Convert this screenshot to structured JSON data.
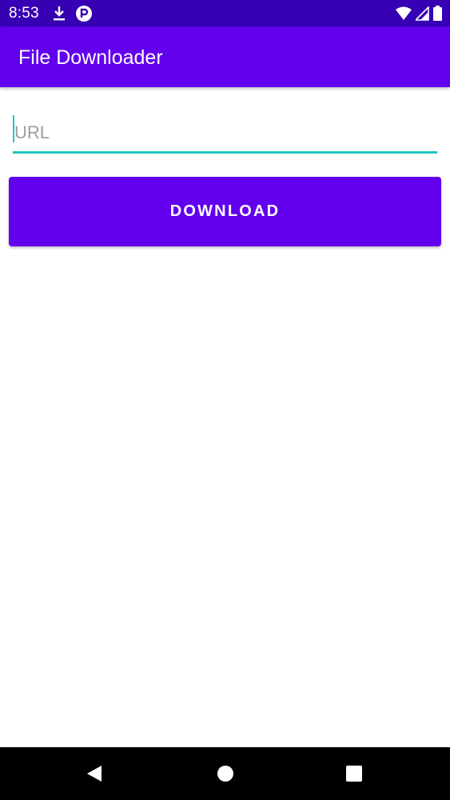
{
  "status_bar": {
    "time": "8:53",
    "left_icons": [
      "download-icon",
      "app-notification-icon"
    ],
    "right_icons": [
      "wifi-icon",
      "cell-signal-icon",
      "battery-icon"
    ]
  },
  "app_bar": {
    "title": "File Downloader"
  },
  "url_input": {
    "placeholder": "URL",
    "value": ""
  },
  "download_button": {
    "label": "DOWNLOAD"
  },
  "nav_bar": {
    "icons": [
      "back-icon",
      "home-icon",
      "recents-icon"
    ]
  },
  "colors": {
    "status_bar": "#3700b3",
    "primary": "#6200ee",
    "accent": "#1fc6be",
    "nav_bar": "#000000"
  }
}
